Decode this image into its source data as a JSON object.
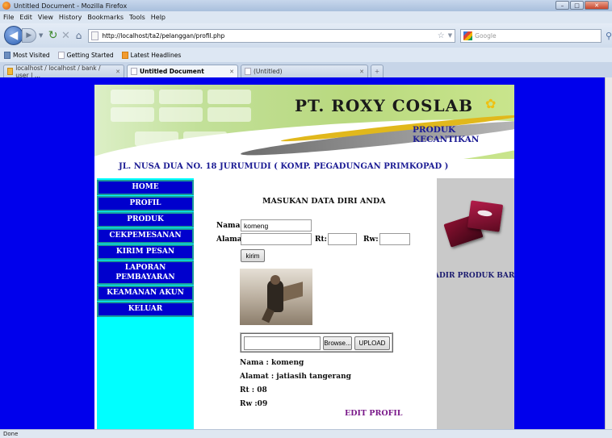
{
  "window": {
    "title": "Untitled Document - Mozilla Firefox"
  },
  "menubar": [
    "File",
    "Edit",
    "View",
    "History",
    "Bookmarks",
    "Tools",
    "Help"
  ],
  "navbar": {
    "url": "http://localhost/ta2/pelanggan/profil.php",
    "search_placeholder": "Google"
  },
  "bookmarks": [
    "Most Visited",
    "Getting Started",
    "Latest Headlines"
  ],
  "tabs": [
    {
      "label": "localhost / localhost / bank / user | ..."
    },
    {
      "label": "Untitled Document"
    },
    {
      "label": "(Untitled)"
    }
  ],
  "page": {
    "brand": "PT. ROXY COSLAB",
    "tagline": "PRODUK KECANTIKAN",
    "address": "JL. NUSA DUA NO. 18 JURUMUDI ( KOMP. PEGADUNGAN PRIMKOPAD )",
    "menu": [
      "HOME",
      "PROFIL",
      "PRODUK",
      "CEKPEMESANAN",
      "KIRIM PESAN",
      "LAPORAN PEMBAYARAN",
      "KEAMANAN AKUN",
      "KELUAR"
    ],
    "form": {
      "title": "MASUKAN DATA DIRI ANDA",
      "nama_label": "Nama",
      "nama_value": "komeng",
      "alamat_label": "Alamat",
      "alamat_value": "",
      "rt_label": "Rt:",
      "rt_value": "",
      "rw_label": "Rw:",
      "rw_value": "",
      "submit": "kirim"
    },
    "upload": {
      "browse": "Browse...",
      "upload": "UPLOAD"
    },
    "profile": {
      "nama": "Nama : komeng",
      "alamat": "Alamat : jatiasih tangerang",
      "rt": "Rt : 08",
      "rw": "Rw :09"
    },
    "edit_link": "EDIT PROFIL",
    "right_panel_text": "ADIR PRODUK BARU"
  },
  "status": "Done"
}
